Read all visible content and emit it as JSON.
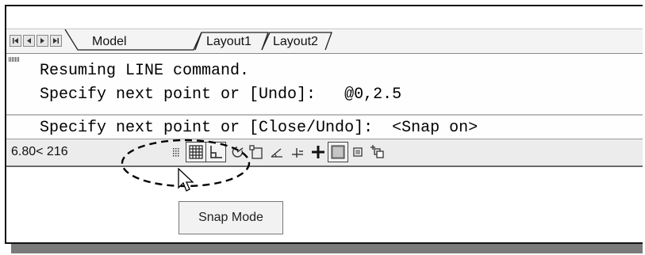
{
  "tabs": {
    "nav_buttons": [
      "first-tab-icon",
      "previous-tab-icon",
      "next-tab-icon",
      "last-tab-icon"
    ],
    "items": [
      {
        "label": "Model",
        "active": true
      },
      {
        "label": "Layout1",
        "active": false
      },
      {
        "label": "Layout2",
        "active": false
      }
    ]
  },
  "command_window": {
    "lines": [
      "Resuming LINE command.",
      "Specify next point or [Undo]:   @0,2.5",
      "Specify next point or [Close/Undo]:  <Snap on>"
    ]
  },
  "status_bar": {
    "coordinates": "6.80< 216",
    "buttons": [
      {
        "name": "snap-mode-icon",
        "pressed": false
      },
      {
        "name": "grid-display-icon",
        "pressed": true
      },
      {
        "name": "ortho-mode-icon",
        "pressed": true
      },
      {
        "name": "polar-tracking-icon",
        "pressed": false
      },
      {
        "name": "object-snap-icon",
        "pressed": false
      },
      {
        "name": "dynamic-ucs-icon",
        "pressed": false
      },
      {
        "name": "object-snap-tracking-icon",
        "pressed": false
      },
      {
        "name": "dynamic-input-icon",
        "pressed": false
      },
      {
        "name": "lineweight-icon",
        "pressed": true
      },
      {
        "name": "quick-properties-icon",
        "pressed": false
      },
      {
        "name": "selection-cycling-icon",
        "pressed": false
      }
    ]
  },
  "annotation": {
    "shape": "dashed-ellipse",
    "color": "#000000"
  },
  "tooltip": {
    "text": "Snap Mode"
  }
}
